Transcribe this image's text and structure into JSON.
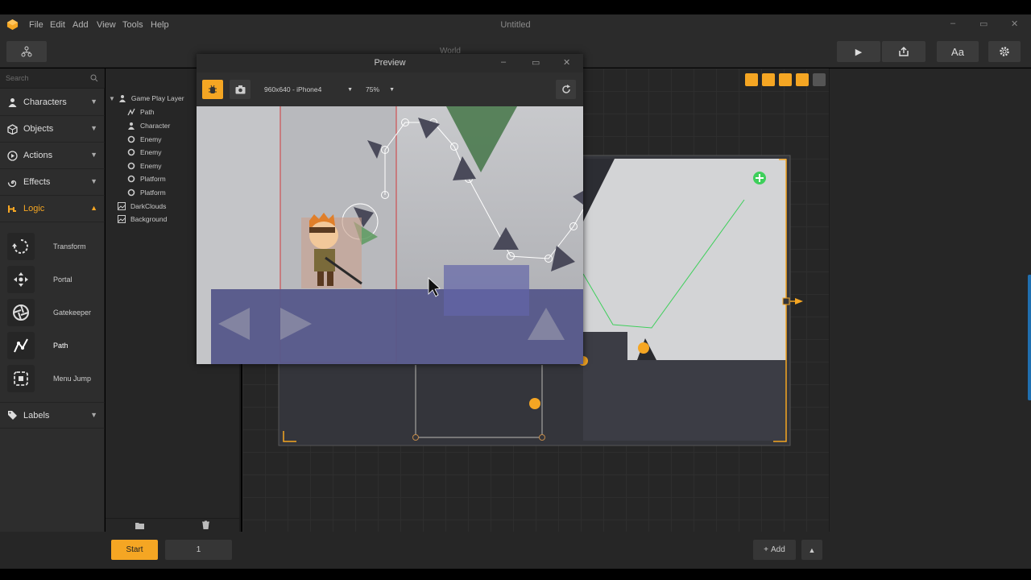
{
  "app": {
    "title": "Untitled",
    "menu": [
      "File",
      "Edit",
      "Add",
      "View",
      "Tools",
      "Help"
    ],
    "window_controls": [
      "–",
      "▭",
      "✕"
    ]
  },
  "toolbar": {
    "world_label": "World",
    "font_button": "Aa"
  },
  "sidebar": {
    "search_placeholder": "Search",
    "categories": [
      {
        "label": "Characters"
      },
      {
        "label": "Objects"
      },
      {
        "label": "Actions"
      },
      {
        "label": "Effects"
      },
      {
        "label": "Logic"
      },
      {
        "label": "Labels"
      }
    ],
    "logic_tools": [
      {
        "label": "Transform"
      },
      {
        "label": "Portal"
      },
      {
        "label": "Gatekeeper"
      },
      {
        "label": "Path"
      },
      {
        "label": "Menu Jump"
      }
    ]
  },
  "layers": {
    "root": "Game Play Layer",
    "children": [
      "Path",
      "Character",
      "Enemy",
      "Enemy",
      "Enemy",
      "Platform",
      "Platform"
    ],
    "others": [
      "DarkClouds",
      "Background"
    ]
  },
  "preview": {
    "title": "Preview",
    "resolution": "960x640 - iPhone4",
    "zoom": "75%"
  },
  "bottom": {
    "start_label": "Start",
    "scene_number": "1",
    "add_label": "Add"
  },
  "colors": {
    "accent": "#f5a623",
    "panel": "#2d2d2d",
    "canvas": "#262626"
  }
}
